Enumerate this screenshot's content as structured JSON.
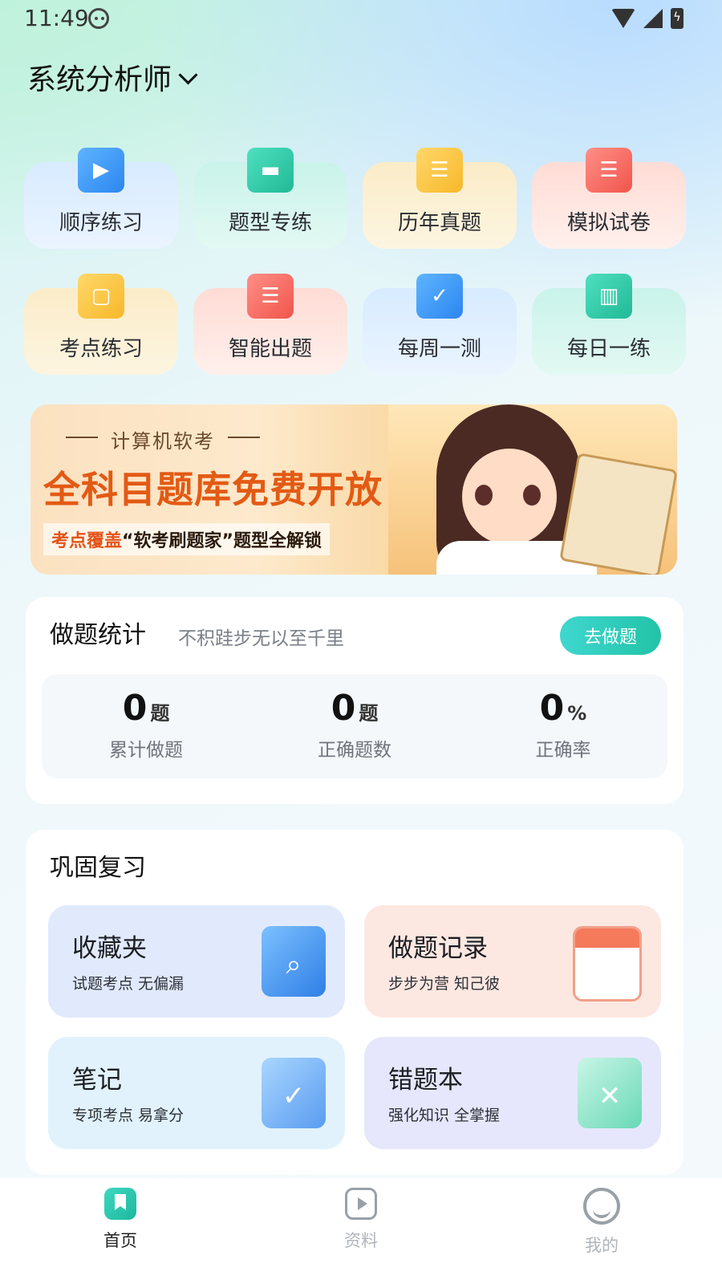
{
  "status": {
    "time": "11:49"
  },
  "header": {
    "subject": "系统分析师"
  },
  "features": [
    {
      "label": "顺序练习",
      "icon": "video-book-icon"
    },
    {
      "label": "题型专练",
      "icon": "card-icon"
    },
    {
      "label": "历年真题",
      "icon": "document-icon"
    },
    {
      "label": "模拟试卷",
      "icon": "paper-icon"
    },
    {
      "label": "考点练习",
      "icon": "tablet-icon"
    },
    {
      "label": "智能出题",
      "icon": "notes-icon"
    },
    {
      "label": "每周一测",
      "icon": "calendar-check-icon"
    },
    {
      "label": "每日一练",
      "icon": "open-book-icon"
    }
  ],
  "banner": {
    "subtitle": "计算机软考",
    "title": "全科目题库免费开放",
    "note_prefix": "考点覆盖",
    "note_highlight": "“软考刷题家”",
    "note_suffix": "题型全解锁"
  },
  "stats": {
    "title": "做题统计",
    "motto": "不积跬步无以至千里",
    "button": "去做题",
    "items": [
      {
        "value": "0",
        "unit": "题",
        "label": "累计做题"
      },
      {
        "value": "0",
        "unit": "题",
        "label": "正确题数"
      },
      {
        "value": "0",
        "unit": "%",
        "label": "正确率"
      }
    ]
  },
  "review": {
    "title": "巩固复习",
    "items": [
      {
        "name": "收藏夹",
        "desc": "试题考点 无偏漏",
        "icon": "folder-search-icon"
      },
      {
        "name": "做题记录",
        "desc": "步步为营 知己彼",
        "icon": "calendar-icon"
      },
      {
        "name": "笔记",
        "desc": "专项考点 易拿分",
        "icon": "clipboard-icon"
      },
      {
        "name": "错题本",
        "desc": "强化知识 全掌握",
        "icon": "error-folder-icon"
      }
    ]
  },
  "nav": [
    {
      "label": "首页",
      "icon": "home-icon"
    },
    {
      "label": "资料",
      "icon": "video-icon"
    },
    {
      "label": "我的",
      "icon": "profile-icon"
    }
  ]
}
